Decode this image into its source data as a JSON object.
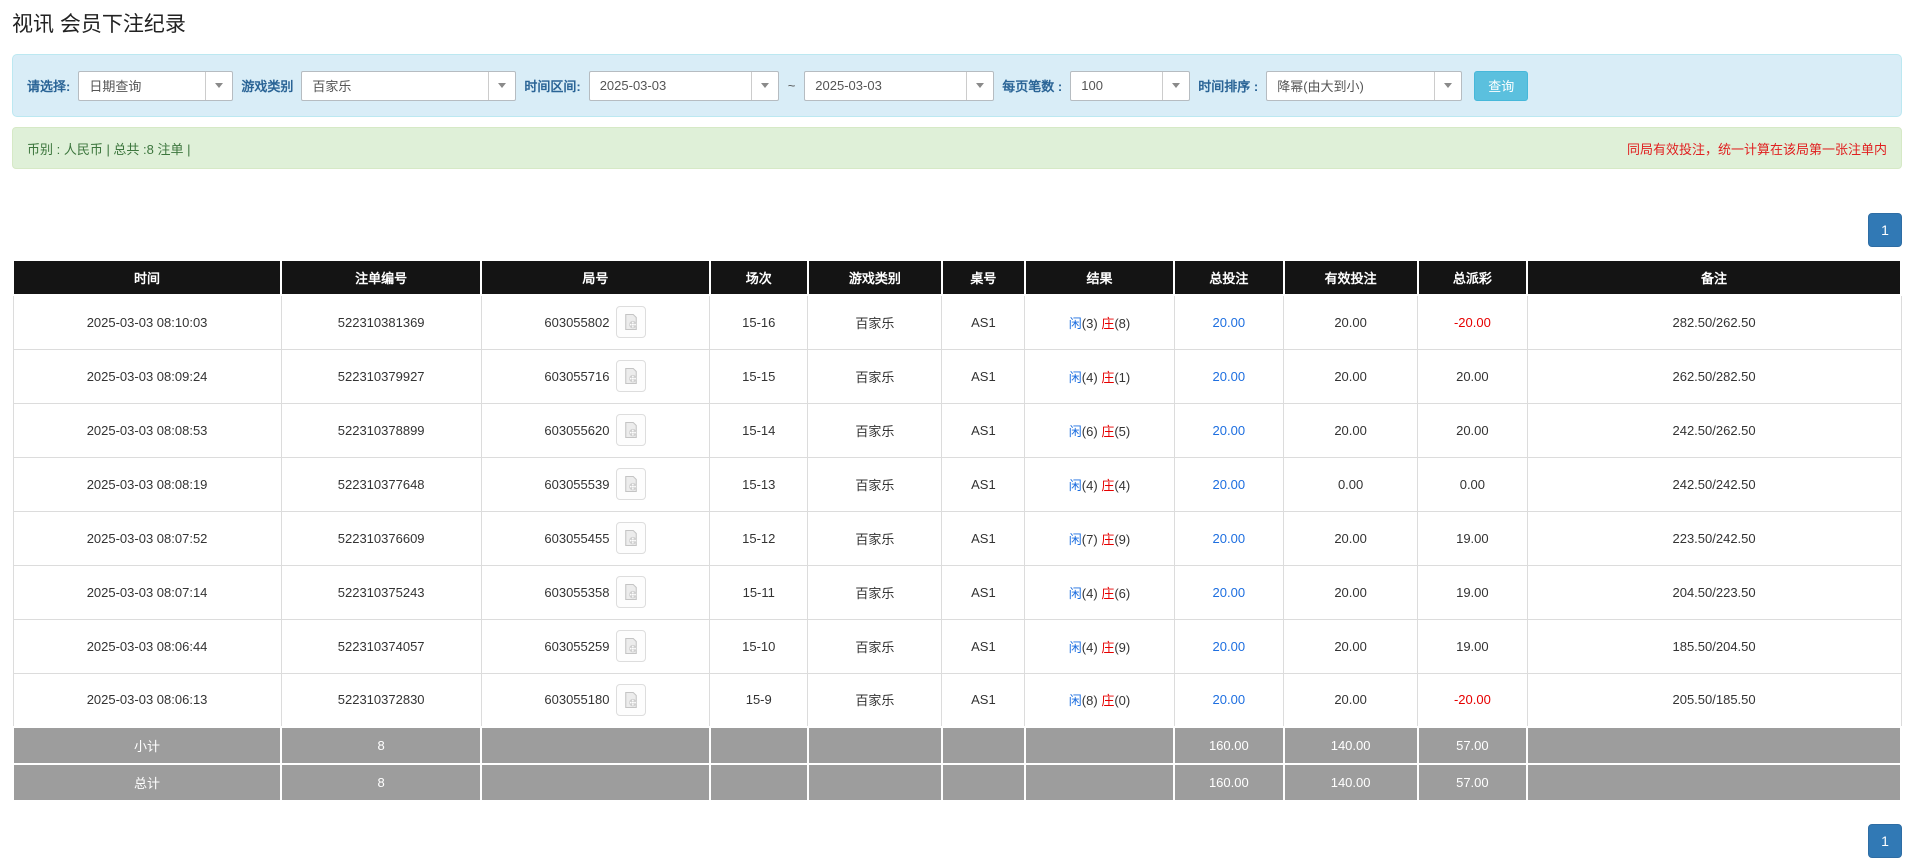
{
  "page": {
    "title": "视讯 会员下注纪录"
  },
  "filters": {
    "query_type_label": "请选择:",
    "query_type_value": "日期查询",
    "game_type_label": "游戏类别",
    "game_type_value": "百家乐",
    "time_range_label": "时间区间:",
    "date_from": "2025-03-03",
    "date_separator": "~",
    "date_to": "2025-03-03",
    "page_size_label": "每页笔数 :",
    "page_size_value": "100",
    "sort_label": "时间排序 :",
    "sort_value": "降幂(由大到小)",
    "search_button": "查询"
  },
  "summary": {
    "left_text": "币别 : 人民币 | 总共 :8 注单 |",
    "right_text": "同局有效投注，统一计算在该局第一张注单内"
  },
  "pagination": {
    "current_page": "1"
  },
  "table": {
    "headers": [
      "时间",
      "注单编号",
      "局号",
      "场次",
      "游戏类别",
      "桌号",
      "结果",
      "总投注",
      "有效投注",
      "总派彩",
      "备注"
    ],
    "rows": [
      {
        "time": "2025-03-03 08:10:03",
        "bet_id": "522310381369",
        "round_id": "603055802",
        "session": "15-16",
        "game": "百家乐",
        "table_no": "AS1",
        "result_player_char": "闲",
        "result_player_num": "(3)",
        "result_banker_char": "庄",
        "result_banker_num": "(8)",
        "total_bet": "20.00",
        "valid_bet": "20.00",
        "payout": "-20.00",
        "remark": "282.50/262.50"
      },
      {
        "time": "2025-03-03 08:09:24",
        "bet_id": "522310379927",
        "round_id": "603055716",
        "session": "15-15",
        "game": "百家乐",
        "table_no": "AS1",
        "result_player_char": "闲",
        "result_player_num": "(4)",
        "result_banker_char": "庄",
        "result_banker_num": "(1)",
        "total_bet": "20.00",
        "valid_bet": "20.00",
        "payout": "20.00",
        "remark": "262.50/282.50"
      },
      {
        "time": "2025-03-03 08:08:53",
        "bet_id": "522310378899",
        "round_id": "603055620",
        "session": "15-14",
        "game": "百家乐",
        "table_no": "AS1",
        "result_player_char": "闲",
        "result_player_num": "(6)",
        "result_banker_char": "庄",
        "result_banker_num": "(5)",
        "total_bet": "20.00",
        "valid_bet": "20.00",
        "payout": "20.00",
        "remark": "242.50/262.50"
      },
      {
        "time": "2025-03-03 08:08:19",
        "bet_id": "522310377648",
        "round_id": "603055539",
        "session": "15-13",
        "game": "百家乐",
        "table_no": "AS1",
        "result_player_char": "闲",
        "result_player_num": "(4)",
        "result_banker_char": "庄",
        "result_banker_num": "(4)",
        "total_bet": "20.00",
        "valid_bet": "0.00",
        "payout": "0.00",
        "remark": "242.50/242.50"
      },
      {
        "time": "2025-03-03 08:07:52",
        "bet_id": "522310376609",
        "round_id": "603055455",
        "session": "15-12",
        "game": "百家乐",
        "table_no": "AS1",
        "result_player_char": "闲",
        "result_player_num": "(7)",
        "result_banker_char": "庄",
        "result_banker_num": "(9)",
        "total_bet": "20.00",
        "valid_bet": "20.00",
        "payout": "19.00",
        "remark": "223.50/242.50"
      },
      {
        "time": "2025-03-03 08:07:14",
        "bet_id": "522310375243",
        "round_id": "603055358",
        "session": "15-11",
        "game": "百家乐",
        "table_no": "AS1",
        "result_player_char": "闲",
        "result_player_num": "(4)",
        "result_banker_char": "庄",
        "result_banker_num": "(6)",
        "total_bet": "20.00",
        "valid_bet": "20.00",
        "payout": "19.00",
        "remark": "204.50/223.50"
      },
      {
        "time": "2025-03-03 08:06:44",
        "bet_id": "522310374057",
        "round_id": "603055259",
        "session": "15-10",
        "game": "百家乐",
        "table_no": "AS1",
        "result_player_char": "闲",
        "result_player_num": "(4)",
        "result_banker_char": "庄",
        "result_banker_num": "(9)",
        "total_bet": "20.00",
        "valid_bet": "20.00",
        "payout": "19.00",
        "remark": "185.50/204.50"
      },
      {
        "time": "2025-03-03 08:06:13",
        "bet_id": "522310372830",
        "round_id": "603055180",
        "session": "15-9",
        "game": "百家乐",
        "table_no": "AS1",
        "result_player_char": "闲",
        "result_player_num": "(8)",
        "result_banker_char": "庄",
        "result_banker_num": "(0)",
        "total_bet": "20.00",
        "valid_bet": "20.00",
        "payout": "-20.00",
        "remark": "205.50/185.50"
      }
    ],
    "subtotal": {
      "label": "小计",
      "count": "8",
      "total_bet": "160.00",
      "valid_bet": "140.00",
      "payout": "57.00"
    },
    "total": {
      "label": "总计",
      "count": "8",
      "total_bet": "160.00",
      "valid_bet": "140.00",
      "payout": "57.00"
    }
  },
  "colors": {
    "filter_bg": "#d9edf7",
    "filter_label": "#2a6496",
    "search_button": "#5bc0de",
    "summary_bg": "#dff0d8",
    "summary_text": "#3c763d",
    "summary_warning": "#e02020",
    "header_bg": "#141414",
    "footer_bg": "#9d9d9d",
    "pagination_active": "#3179b5",
    "bet_blue": "#1e6fe0",
    "loss_red": "#e60000",
    "player_blue": "#1e6fe0",
    "banker_red": "#e60000"
  }
}
